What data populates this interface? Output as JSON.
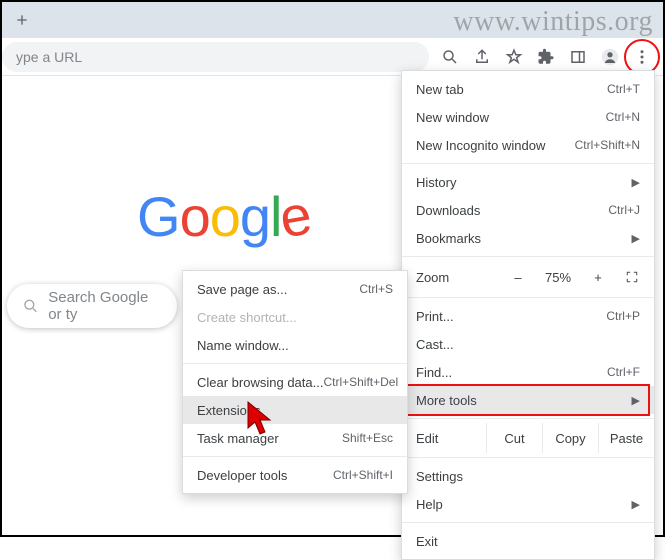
{
  "watermark": "www.wintips.org",
  "omnibox_placeholder": "ype a URL",
  "search_placeholder": "Search Google or ty",
  "google_logo": [
    "G",
    "o",
    "o",
    "g",
    "l",
    "e"
  ],
  "menu": {
    "new_tab": {
      "label": "New tab",
      "shortcut": "Ctrl+T"
    },
    "new_window": {
      "label": "New window",
      "shortcut": "Ctrl+N"
    },
    "incognito": {
      "label": "New Incognito window",
      "shortcut": "Ctrl+Shift+N"
    },
    "history": {
      "label": "History"
    },
    "downloads": {
      "label": "Downloads",
      "shortcut": "Ctrl+J"
    },
    "bookmarks": {
      "label": "Bookmarks"
    },
    "zoom": {
      "label": "Zoom",
      "minus": "–",
      "value": "75%",
      "plus": "+"
    },
    "print": {
      "label": "Print...",
      "shortcut": "Ctrl+P"
    },
    "cast": {
      "label": "Cast..."
    },
    "find": {
      "label": "Find...",
      "shortcut": "Ctrl+F"
    },
    "more_tools": {
      "label": "More tools"
    },
    "edit": {
      "label": "Edit",
      "cut": "Cut",
      "copy": "Copy",
      "paste": "Paste"
    },
    "settings": {
      "label": "Settings"
    },
    "help": {
      "label": "Help"
    },
    "exit": {
      "label": "Exit"
    }
  },
  "submenu": {
    "save_page": {
      "label": "Save page as...",
      "shortcut": "Ctrl+S"
    },
    "create_shortcut": {
      "label": "Create shortcut..."
    },
    "name_window": {
      "label": "Name window..."
    },
    "clear_data": {
      "label": "Clear browsing data...",
      "shortcut": "Ctrl+Shift+Del"
    },
    "extensions": {
      "label": "Extensions"
    },
    "task_manager": {
      "label": "Task manager",
      "shortcut": "Shift+Esc"
    },
    "dev_tools": {
      "label": "Developer tools",
      "shortcut": "Ctrl+Shift+I"
    }
  }
}
